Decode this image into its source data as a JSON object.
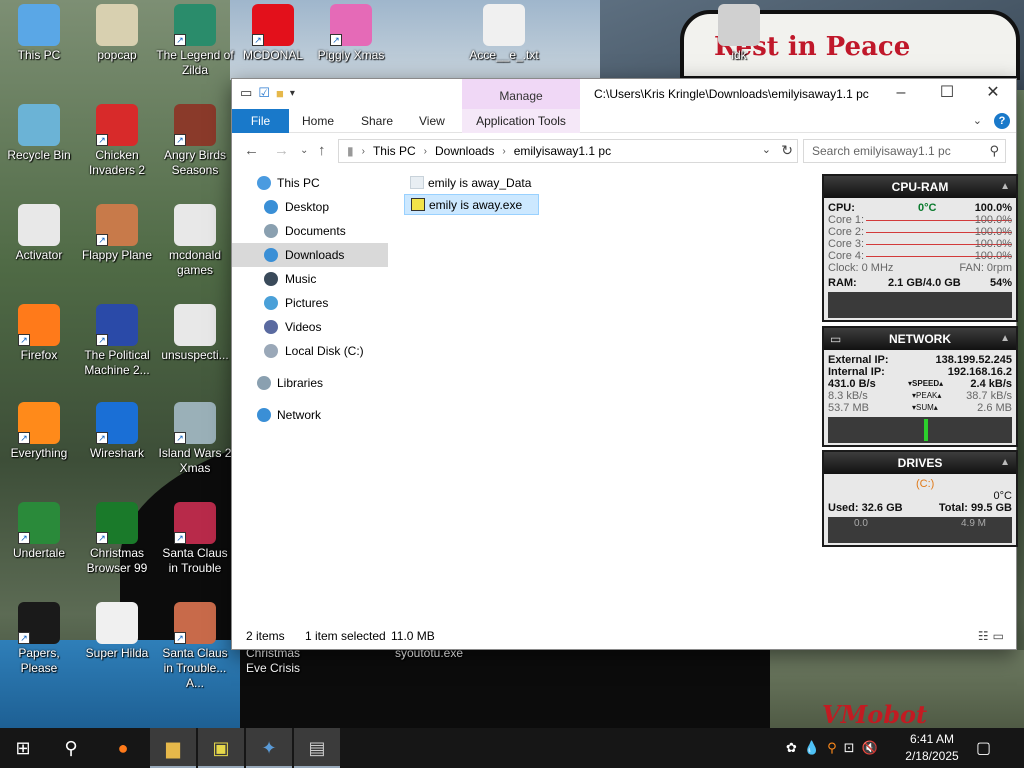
{
  "desktop": {
    "icons": [
      {
        "label": "This PC",
        "icon": "this-pc-icon",
        "color": "#5aa7e6"
      },
      {
        "label": "popcap",
        "icon": "popcap-folder-icon",
        "color": "#d8d0b0"
      },
      {
        "label": "The Legend of Zilda",
        "icon": "zilda-game-icon",
        "color": "#2a8c6b"
      },
      {
        "label": "MCDONAL",
        "icon": "mcdonalds-icon",
        "color": "#e3101b"
      },
      {
        "label": "Piggly Xmas",
        "icon": "piggly-xmas-icon",
        "color": "#e56ab7"
      },
      {
        "label": "Acce__e_.txt",
        "icon": "text-file-icon",
        "color": "#f0f0f0"
      },
      {
        "label": "idk",
        "icon": "idk-folder-icon",
        "color": "#d0d0d0"
      },
      {
        "label": "Recycle Bin",
        "icon": "recycle-bin-icon",
        "color": "#6bb3d6"
      },
      {
        "label": "Chicken Invaders 2",
        "icon": "chicken-invaders-icon",
        "color": "#d82a2a"
      },
      {
        "label": "Angry Birds Seasons",
        "icon": "angry-birds-icon",
        "color": "#8a3a2a"
      },
      {
        "label": "Activator",
        "icon": "activator-file-icon",
        "color": "#e8e8e8"
      },
      {
        "label": "Flappy Plane",
        "icon": "flappy-plane-icon",
        "color": "#c87a4a"
      },
      {
        "label": "mcdonald games",
        "icon": "mcdonald-games-file-icon",
        "color": "#e8e8e8"
      },
      {
        "label": "Firefox",
        "icon": "firefox-icon",
        "color": "#ff7a1a"
      },
      {
        "label": "The Political Machine 2...",
        "icon": "political-machine-icon",
        "color": "#2a4aa8"
      },
      {
        "label": "unsuspecti...",
        "icon": "unsuspecting-file-icon",
        "color": "#e8e8e8"
      },
      {
        "label": "Everything",
        "icon": "everything-search-icon",
        "color": "#ff8a1a"
      },
      {
        "label": "Wireshark",
        "icon": "wireshark-icon",
        "color": "#1a6fd6"
      },
      {
        "label": "Island Wars 2 Xmas",
        "icon": "island-wars-icon",
        "color": "#9ab0b8"
      },
      {
        "label": "Undertale",
        "icon": "undertale-icon",
        "color": "#2a8a3a"
      },
      {
        "label": "Christmas Browser 99",
        "icon": "christmas-browser-icon",
        "color": "#1a7a2a"
      },
      {
        "label": "Santa Claus in Trouble",
        "icon": "santa-claus-icon",
        "color": "#b82a4a"
      },
      {
        "label": "Papers, Please",
        "icon": "papers-please-icon",
        "color": "#1a1a1a"
      },
      {
        "label": "Super Hilda",
        "icon": "super-hilda-icon",
        "color": "#f0f0f0"
      },
      {
        "label": "Santa Claus in Trouble... A...",
        "icon": "santa-claus-again-icon",
        "color": "#c86a4a"
      },
      {
        "label": "Christmas Eve Crisis",
        "icon": "christmas-eve-crisis-icon",
        "color": "#1a1a1a"
      },
      {
        "label": "syoutotu.exe",
        "icon": "syoutotu-exe-icon",
        "color": "#1a1a1a"
      }
    ],
    "sign_text": "Rest in Peace",
    "signature_text": "VMobot"
  },
  "explorer": {
    "manage_tab": "Manage",
    "title_path": "C:\\Users\\Kris Kringle\\Downloads\\emilyisaway1.1 pc",
    "ribbon": {
      "file": "File",
      "home": "Home",
      "share": "Share",
      "view": "View",
      "app_tools": "Application Tools"
    },
    "breadcrumb": [
      "This PC",
      "Downloads",
      "emilyisaway1.1 pc"
    ],
    "search_placeholder": "Search emilyisaway1.1 pc",
    "nav": [
      {
        "label": "This PC",
        "level": 0,
        "color": "#4a9be0"
      },
      {
        "label": "Desktop",
        "level": 1,
        "color": "#3a8fd6"
      },
      {
        "label": "Documents",
        "level": 1,
        "color": "#8aa0b0"
      },
      {
        "label": "Downloads",
        "level": 1,
        "color": "#3a8fd6",
        "selected": true
      },
      {
        "label": "Music",
        "level": 1,
        "color": "#3a4a5a"
      },
      {
        "label": "Pictures",
        "level": 1,
        "color": "#4aa0d8"
      },
      {
        "label": "Videos",
        "level": 1,
        "color": "#5a6aa0"
      },
      {
        "label": "Local Disk (C:)",
        "level": 1,
        "color": "#9aa8b8"
      },
      {
        "label": "Libraries",
        "level": 0,
        "color": "#8aa0b0"
      },
      {
        "label": "Network",
        "level": 0,
        "color": "#3a8fd6"
      }
    ],
    "files": [
      {
        "name": "emily is away_Data",
        "type": "folder"
      },
      {
        "name": "emily is away.exe",
        "type": "exe",
        "selected": true
      }
    ],
    "status": {
      "count": "2 items",
      "selection": "1 item selected",
      "size": "11.0 MB"
    }
  },
  "gadgets": {
    "cpu_ram": {
      "title": "CPU-RAM",
      "cpu_label": "CPU:",
      "cpu_temp": "0°C",
      "cpu_pct": "100.0%",
      "cores": [
        {
          "label": "Core 1:",
          "value": "100.0%"
        },
        {
          "label": "Core 2:",
          "value": "100.0%"
        },
        {
          "label": "Core 3:",
          "value": "100.0%"
        },
        {
          "label": "Core 4:",
          "value": "100.0%"
        }
      ],
      "clock": "Clock: 0 MHz",
      "fan": "FAN: 0rpm",
      "ram_label": "RAM:",
      "ram_value": "2.1 GB/4.0 GB",
      "ram_pct": "54%"
    },
    "network": {
      "title": "NETWORK",
      "external_label": "External IP:",
      "external_ip": "138.199.52.245",
      "internal_label": "Internal IP:",
      "internal_ip": "192.168.16.2",
      "speed_down": "431.0 B/s",
      "speed_label": "SPEED",
      "speed_up": "2.4 kB/s",
      "peak_down": "8.3 kB/s",
      "peak_label": "PEAK",
      "peak_up": "38.7 kB/s",
      "sum_down": "53.7 MB",
      "sum_label": "SUM",
      "sum_up": "2.6 MB"
    },
    "drives": {
      "title": "DRIVES",
      "drive_letter": "(C:)",
      "temp": "0°C",
      "used": "Used: 32.6 GB",
      "total": "Total: 99.5 GB",
      "read": "0.0",
      "write": "4.9 M"
    }
  },
  "taskbar": {
    "clock_time": "6:41 AM",
    "clock_date": "2/18/2025"
  }
}
